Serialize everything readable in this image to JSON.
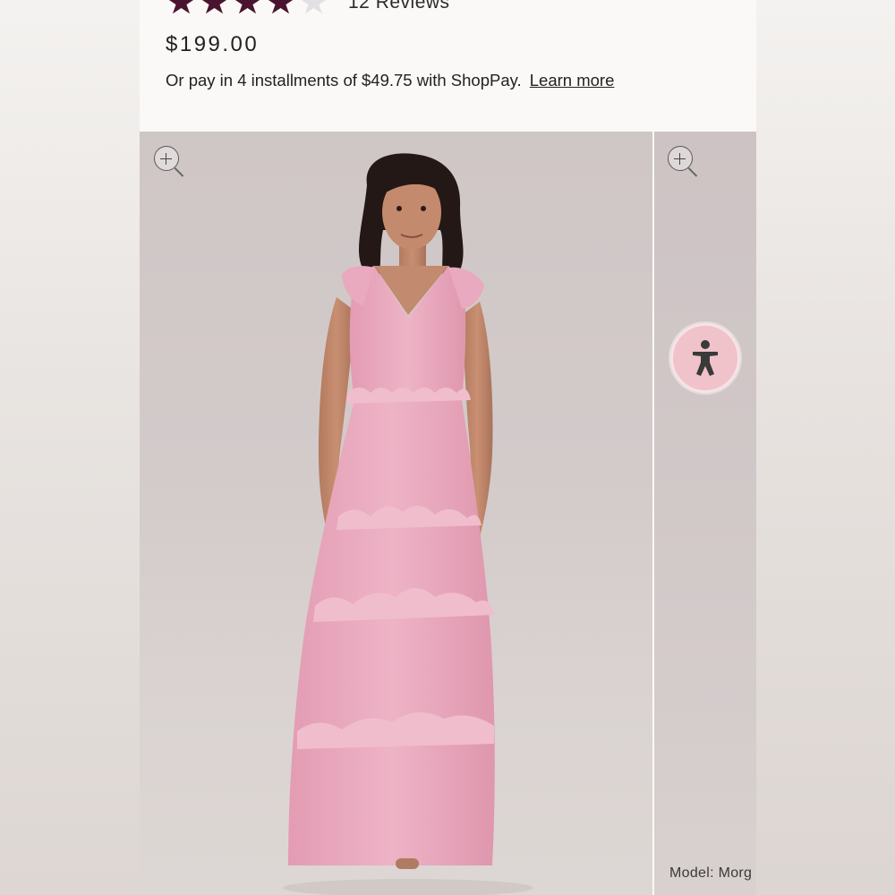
{
  "product": {
    "rating": {
      "stars_filled": 4,
      "stars_total": 5,
      "reviews_label": "12 Reviews"
    },
    "price": "$199.00",
    "installments": {
      "text": "Or pay in 4 installments of $49.75 with ShopPay.",
      "link_label": "Learn more"
    }
  },
  "gallery": {
    "images": [
      {
        "subject": "model-in-pink-tiered-ruffle-maxi-dress"
      },
      {
        "subject": "next-product-image"
      }
    ],
    "caption": "Model: Morg"
  },
  "colors": {
    "star_filled": "#4a1430",
    "star_empty": "#e2e0e2",
    "accessibility_button": "#efc3c9",
    "dress_pink": "#e8a9bd"
  },
  "icons": [
    "star-icon",
    "zoom-icon",
    "accessibility-icon"
  ]
}
